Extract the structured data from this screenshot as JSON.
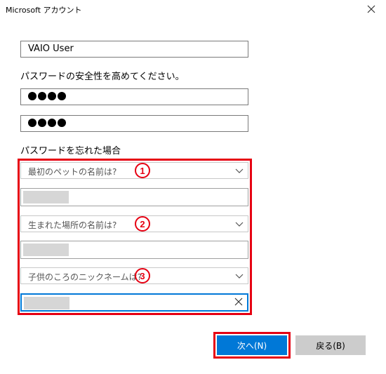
{
  "window": {
    "title": "Microsoft アカウント",
    "close_icon": "close-icon"
  },
  "form": {
    "username_value": "VAIO User",
    "password_prompt": "パスワードの安全性を高めてください。",
    "password_dots": 4,
    "confirm_dots": 4,
    "forgot_label": "パスワードを忘れた場合"
  },
  "questions": [
    {
      "number": "1",
      "placeholder": "最初のペットの名前は?",
      "answer_masked": true
    },
    {
      "number": "2",
      "placeholder": "生まれた場所の名前は?",
      "answer_masked": true
    },
    {
      "number": "3",
      "placeholder": "子供のころのニックネームは?",
      "answer_masked": true,
      "active": true
    }
  ],
  "buttons": {
    "next_label": "次へ(N)",
    "back_label": "戻る(B)"
  },
  "colors": {
    "accent": "#0078d7",
    "highlight": "#e60012"
  }
}
